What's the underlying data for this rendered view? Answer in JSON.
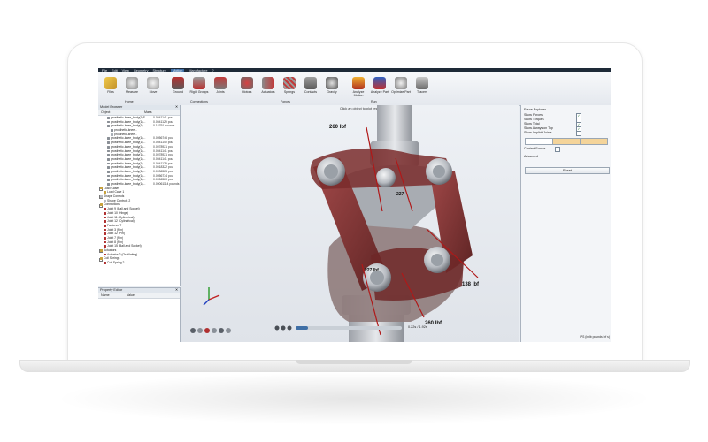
{
  "menubar": {
    "items": [
      "File",
      "Edit",
      "View",
      "Geometry",
      "Structure",
      "Motion",
      "Manufacture",
      "?"
    ],
    "active_index": 5
  },
  "ribbon": {
    "buttons": [
      {
        "label": "Files",
        "icon": "folder-icon"
      },
      {
        "label": "Measure",
        "icon": "measure-icon"
      },
      {
        "label": "Move",
        "icon": "move-icon"
      },
      {
        "label": "Ground",
        "icon": "ground-icon"
      },
      {
        "label": "Rigid Groups",
        "icon": "rigid-groups-icon"
      },
      {
        "label": "Joints",
        "icon": "joints-icon"
      },
      {
        "label": "Motors",
        "icon": "motor-icon"
      },
      {
        "label": "Actuators",
        "icon": "actuator-icon"
      },
      {
        "label": "Springs",
        "icon": "spring-icon"
      },
      {
        "label": "Contacts",
        "icon": "contacts-icon"
      },
      {
        "label": "Gravity",
        "icon": "gravity-icon"
      },
      {
        "label": "Analyze Motion",
        "icon": "analyze-motion-icon"
      },
      {
        "label": "Analyze Part",
        "icon": "analyze-part-icon"
      },
      {
        "label": "Optimize Part",
        "icon": "optimize-part-icon"
      },
      {
        "label": "Tracers",
        "icon": "tracers-icon"
      }
    ],
    "group_labels": [
      "Home",
      "Connections",
      "Forces",
      "Run"
    ]
  },
  "model_browser": {
    "title": "Model Browser",
    "col_object": "Object",
    "col_mass": "Mass",
    "rows": [
      {
        "name": "prosthetic-knee_body(1)S...",
        "value": "0.0041141 pou",
        "indent": 14,
        "color": "#8a8f96"
      },
      {
        "name": "prosthetic-knee_body(1)...",
        "value": "0.0041129 pou",
        "indent": 14,
        "color": "#8a8f96"
      },
      {
        "name": "prosthetic-knee_body(1)...",
        "value": "0.16791 pounds",
        "indent": 14,
        "color": "#8a8f96"
      },
      {
        "name": "prosthetic-knee...",
        "value": "",
        "indent": 18,
        "color": "#8a8f96"
      },
      {
        "name": "prosthetic-knee...",
        "value": "",
        "indent": 18,
        "color": "#a7adb4"
      },
      {
        "name": "prosthetic-knee_body(1)...",
        "value": "0.0056746 pou",
        "indent": 14,
        "color": "#8a8f96"
      },
      {
        "name": "prosthetic-knee_body(1)...",
        "value": "0.0041140 pou",
        "indent": 14,
        "color": "#8a8f96"
      },
      {
        "name": "prosthetic-knee_body(1)...",
        "value": "0.0078921 pou",
        "indent": 14,
        "color": "#8a8f96"
      },
      {
        "name": "prosthetic-knee_body(1)...",
        "value": "0.0041141 pou",
        "indent": 14,
        "color": "#8a8f96"
      },
      {
        "name": "prosthetic-knee_body(1)...",
        "value": "0.0078921 pou",
        "indent": 14,
        "color": "#8a8f96"
      },
      {
        "name": "prosthetic-knee_body(1)...",
        "value": "0.0041141 pou",
        "indent": 14,
        "color": "#8a8f96"
      },
      {
        "name": "prosthetic-knee_body(1)...",
        "value": "0.0041129 pou",
        "indent": 14,
        "color": "#8a8f96"
      },
      {
        "name": "prosthetic-knee_body(1)...",
        "value": "0.0018322 pou",
        "indent": 14,
        "color": "#8a8f96"
      },
      {
        "name": "prosthetic-knee_body(1)...",
        "value": "0.0036525 pou",
        "indent": 14,
        "color": "#8a8f96"
      },
      {
        "name": "prosthetic-knee_body(1)...",
        "value": "0.0056734 pou",
        "indent": 14,
        "color": "#8a8f96"
      },
      {
        "name": "prosthetic-knee_body(1)...",
        "value": "0.0056580 pou",
        "indent": 14,
        "color": "#8a8f96"
      },
      {
        "name": "prosthetic-knee_body(1)...",
        "value": "0.00061114 pounds",
        "indent": 14,
        "color": "#8a8f96"
      },
      {
        "name": "Load Cases",
        "value": "",
        "indent": 6,
        "color": "#c9a23a"
      },
      {
        "name": "Load Case 1",
        "value": "",
        "indent": 10,
        "color": "#c9a23a"
      },
      {
        "name": "Shape Controls",
        "value": "",
        "indent": 6,
        "color": "#b8bcc2"
      },
      {
        "name": "Shape Controls 2",
        "value": "",
        "indent": 10,
        "color": "#b8bcc2"
      },
      {
        "name": "Connections",
        "value": "",
        "indent": 6,
        "color": "#c9a23a"
      },
      {
        "name": "Joint 9 (Ball and Socket)",
        "value": "",
        "indent": 10,
        "color": "#b03030"
      },
      {
        "name": "Joint 10 (Hinge)",
        "value": "",
        "indent": 10,
        "color": "#b03030"
      },
      {
        "name": "Joint 11 (Cylindrical)",
        "value": "",
        "indent": 10,
        "color": "#b03030"
      },
      {
        "name": "Joint 12 (Cylindrical)",
        "value": "",
        "indent": 10,
        "color": "#b03030"
      },
      {
        "name": "Fastener 7",
        "value": "",
        "indent": 10,
        "color": "#b03030"
      },
      {
        "name": "Joint 3 (Pin)",
        "value": "",
        "indent": 10,
        "color": "#b03030"
      },
      {
        "name": "Joint 12 (Pin)",
        "value": "",
        "indent": 10,
        "color": "#b03030"
      },
      {
        "name": "Joint 7 (Pin)",
        "value": "",
        "indent": 10,
        "color": "#b03030"
      },
      {
        "name": "Joint 8 (Pin)",
        "value": "",
        "indent": 10,
        "color": "#b03030"
      },
      {
        "name": "Joint 15 (Ball and Socket)",
        "value": "",
        "indent": 10,
        "color": "#b03030"
      },
      {
        "name": "Actuators",
        "value": "",
        "indent": 6,
        "color": "#c9a23a"
      },
      {
        "name": "Actuator 2 (Oscillating)",
        "value": "",
        "indent": 10,
        "color": "#b03030"
      },
      {
        "name": "Coil Springs",
        "value": "",
        "indent": 6,
        "color": "#c9a23a"
      },
      {
        "name": "Coil Spring 2",
        "value": "",
        "indent": 10,
        "color": "#b03030"
      }
    ]
  },
  "property_editor": {
    "title": "Property Editor",
    "col_name": "Name",
    "col_value": "Value"
  },
  "viewport": {
    "hint": "Click an object to plot results",
    "force_labels": [
      "260 lbf",
      "227 lbf",
      "138 lbf",
      "260 lbf",
      "227"
    ],
    "playback_time": "0.22s / 1.92s"
  },
  "force_explorer": {
    "title": "Force Explorer",
    "options": [
      {
        "label": "Show Forces",
        "checked": true
      },
      {
        "label": "Show Torques",
        "checked": false
      },
      {
        "label": "Show Total",
        "checked": true
      },
      {
        "label": "Show Always on Top",
        "checked": true
      },
      {
        "label": "Show Implicit Joints",
        "checked": false
      }
    ],
    "contact_forces_label": "Contact Forces",
    "advanced_label": "Advanced",
    "reset_label": "Reset"
  },
  "status": {
    "units": "IPS (in lb pounds lbf s)"
  },
  "colors": {
    "link": "#7a2c2c",
    "pin": "#c8cbd0",
    "arrow": "#b01818",
    "accent": "#3f6fa6"
  }
}
